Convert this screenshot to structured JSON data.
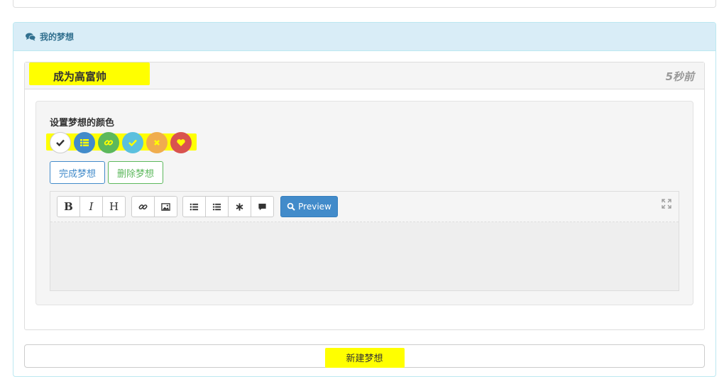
{
  "panel": {
    "heading": "我的梦想"
  },
  "dream": {
    "title": "成为高富帅",
    "time": "5秒前",
    "color_label": "设置梦想的颜色",
    "color_options": [
      {
        "name": "white",
        "color": "#ffffff",
        "icon": "check-icon"
      },
      {
        "name": "blue",
        "color": "#428bca",
        "icon": "list-icon"
      },
      {
        "name": "green",
        "color": "#5cb85c",
        "icon": "link-icon"
      },
      {
        "name": "cyan",
        "color": "#5bc0de",
        "icon": "check-icon"
      },
      {
        "name": "orange",
        "color": "#f0ad4e",
        "icon": "close-icon"
      },
      {
        "name": "red",
        "color": "#d9534f",
        "icon": "heart-icon"
      }
    ],
    "complete_label": "完成梦想",
    "delete_label": "删除梦想"
  },
  "editor": {
    "bold": "B",
    "italic": "I",
    "heading": "H",
    "preview_label": "Preview",
    "content": ""
  },
  "new_dream_label": "新建梦想",
  "colors": {
    "highlight": "#ffff00",
    "primary": "#428bca",
    "success": "#5cb85c",
    "info_bg": "#d9edf7"
  }
}
